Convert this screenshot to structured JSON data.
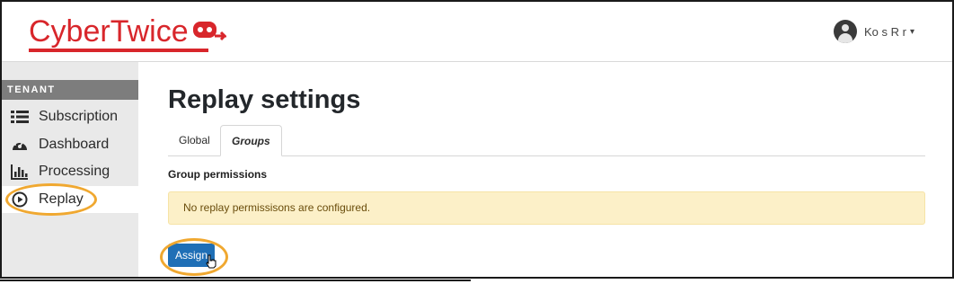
{
  "header": {
    "logo_text": "CyberTwice",
    "user_name": "Ko  s R      r",
    "user_caret": "▾"
  },
  "sidebar": {
    "section_label": "TENANT",
    "items": [
      {
        "label": "Subscription",
        "icon": "list-icon"
      },
      {
        "label": "Dashboard",
        "icon": "tachometer-icon"
      },
      {
        "label": "Processing",
        "icon": "bar-chart-icon"
      },
      {
        "label": "Replay",
        "icon": "play-circle-icon",
        "active": true
      }
    ]
  },
  "main": {
    "title": "Replay settings",
    "tabs": [
      {
        "label": "Global",
        "active": false
      },
      {
        "label": "Groups",
        "active": true
      }
    ],
    "section_title": "Group permissions",
    "alert_text": "No replay permissisons are configured.",
    "assign_label": "Assign"
  },
  "colors": {
    "brand_red": "#d8262b",
    "highlight_ring": "#f0a830",
    "primary_button": "#1f6fb6",
    "alert_bg": "#fcf0c8"
  }
}
